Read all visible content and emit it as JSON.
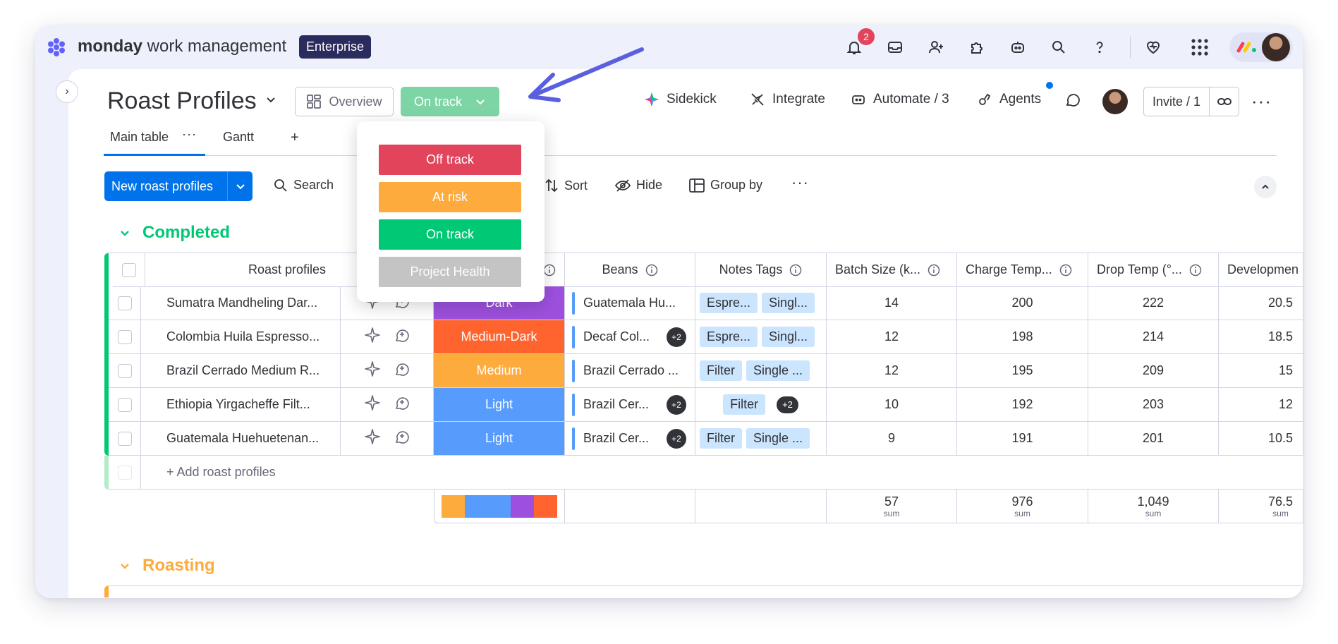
{
  "topbar": {
    "brand_bold": "monday",
    "brand_rest": " work management",
    "plan_badge": "Enterprise",
    "notification_count": "2"
  },
  "header": {
    "board_title": "Roast Profiles",
    "overview_label": "Overview",
    "status_label": "On track",
    "sidekick": "Sidekick",
    "integrate": "Integrate",
    "automate": "Automate / 3",
    "agents": "Agents",
    "invite": "Invite / 1"
  },
  "tabs": [
    {
      "label": "Main table"
    },
    {
      "label": "Gantt"
    },
    {
      "label": "+"
    }
  ],
  "toolbar": {
    "new_label": "New roast profiles",
    "search": "Search",
    "sort": "Sort",
    "hide": "Hide",
    "group_by": "Group by"
  },
  "status_menu": {
    "items": [
      {
        "label": "Off track",
        "color": "#e2445c"
      },
      {
        "label": "At risk",
        "color": "#fdab3d"
      },
      {
        "label": "On track",
        "color": "#00c875"
      },
      {
        "label": "Project Health",
        "color": "#c4c4c4"
      }
    ]
  },
  "groups": [
    {
      "title": "Completed",
      "color": "#00c875",
      "columns": [
        "Roast profiles",
        "Beans",
        "Notes Tags",
        "Batch Size (k...",
        "Charge Temp...",
        "Drop Temp (°...",
        "Developmen"
      ],
      "rows": [
        {
          "name": "Sumatra Mandheling Dar...",
          "level": "Dark",
          "level_color": "#9d50dd",
          "beans": "Guatemala Hu...",
          "beans_extra": "",
          "tags": [
            "Espre...",
            "Singl..."
          ],
          "tags_extra": "",
          "batch": "14",
          "charge": "200",
          "drop": "222",
          "dev": "20.5"
        },
        {
          "name": "Colombia Huila Espresso...",
          "level": "Medium-Dark",
          "level_color": "#ff642e",
          "beans": "Decaf Col...",
          "beans_extra": "+2",
          "tags": [
            "Espre...",
            "Singl..."
          ],
          "tags_extra": "",
          "batch": "12",
          "charge": "198",
          "drop": "214",
          "dev": "18.5"
        },
        {
          "name": "Brazil Cerrado Medium R...",
          "level": "Medium",
          "level_color": "#fdab3d",
          "beans": "Brazil Cerrado ...",
          "beans_extra": "",
          "tags": [
            "Filter",
            "Single ..."
          ],
          "tags_extra": "",
          "batch": "12",
          "charge": "195",
          "drop": "209",
          "dev": "15"
        },
        {
          "name": "Ethiopia Yirgacheffe Filt...",
          "level": "Light",
          "level_color": "#579bfc",
          "beans": "Brazil Cer...",
          "beans_extra": "+2",
          "tags": [
            "Filter"
          ],
          "tags_extra": "+2",
          "batch": "10",
          "charge": "192",
          "drop": "203",
          "dev": "12"
        },
        {
          "name": "Guatemala Huehuetenan...",
          "level": "Light",
          "level_color": "#579bfc",
          "beans": "Brazil Cer...",
          "beans_extra": "+2",
          "tags": [
            "Filter",
            "Single ..."
          ],
          "tags_extra": "",
          "batch": "9",
          "charge": "191",
          "drop": "201",
          "dev": "10.5"
        }
      ],
      "add_label": "+ Add roast profiles",
      "summary": {
        "level_shares": [
          {
            "color": "#fdab3d",
            "share": 0.2
          },
          {
            "color": "#579bfc",
            "share": 0.4
          },
          {
            "color": "#9d50dd",
            "share": 0.2
          },
          {
            "color": "#ff642e",
            "share": 0.2
          }
        ],
        "batch": "57",
        "charge": "976",
        "drop": "1,049",
        "dev": "76.5",
        "sum_label": "sum"
      }
    },
    {
      "title": "Roasting",
      "color": "#fdab3d"
    }
  ]
}
